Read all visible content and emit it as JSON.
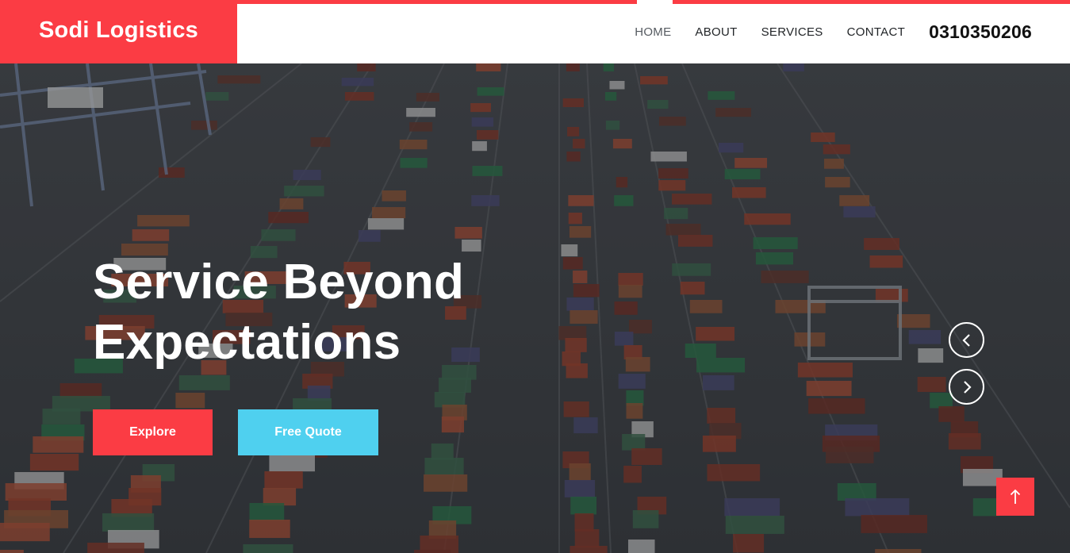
{
  "brand": {
    "name": "Sodi Logistics",
    "color": "#fb3c44"
  },
  "nav": {
    "items": [
      {
        "label": "HOME",
        "active": true
      },
      {
        "label": "ABOUT"
      },
      {
        "label": "SERVICES"
      },
      {
        "label": "CONTACT"
      }
    ],
    "phone": "0310350206"
  },
  "hero": {
    "title_line1": "Service Beyond",
    "title_line2": "Expectations",
    "image": "aerial-container-port",
    "buttons": {
      "explore": "Explore",
      "quote": "Free Quote"
    },
    "colors": {
      "explore": "#fb3c44",
      "quote": "#4fd0ef"
    }
  },
  "controls": {
    "prev_icon": "chevron-left-icon",
    "next_icon": "chevron-right-icon",
    "back_to_top_icon": "arrow-up-icon"
  }
}
